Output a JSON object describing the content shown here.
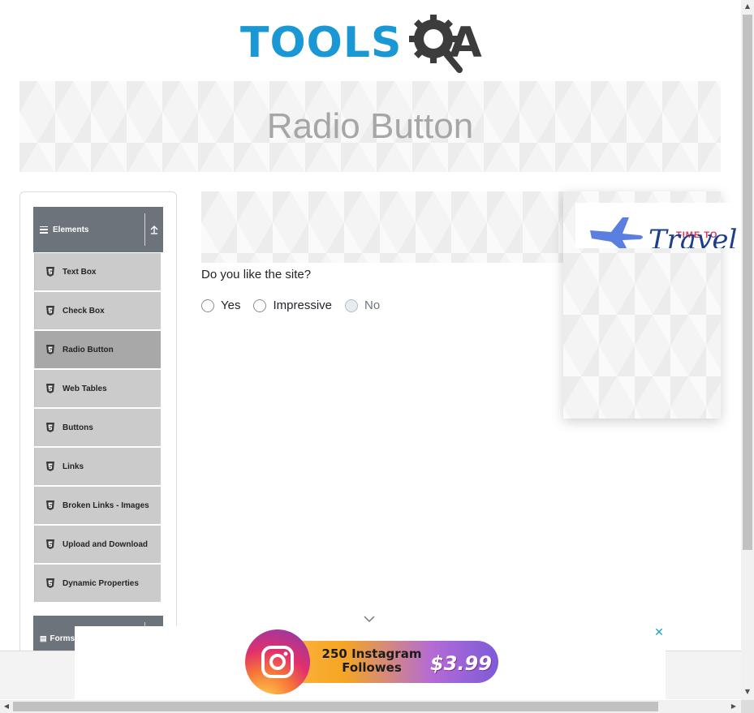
{
  "header": {
    "logo_text_tools": "TOOLS",
    "logo_text_qa": "A"
  },
  "banner": {
    "title": "Radio Button"
  },
  "sidebar": {
    "group_elements": "Elements",
    "group_forms": "Forms",
    "items": [
      {
        "label": "Text Box"
      },
      {
        "label": "Check Box"
      },
      {
        "label": "Radio Button",
        "active": true
      },
      {
        "label": "Web Tables"
      },
      {
        "label": "Buttons"
      },
      {
        "label": "Links"
      },
      {
        "label": "Broken Links - Images"
      },
      {
        "label": "Upload and Download"
      },
      {
        "label": "Dynamic Properties"
      }
    ]
  },
  "main": {
    "question": "Do you like the site?",
    "options": [
      {
        "label": "Yes",
        "selected": false,
        "disabled": false
      },
      {
        "label": "Impressive",
        "selected": false,
        "disabled": false
      },
      {
        "label": "No",
        "selected": false,
        "disabled": true
      }
    ]
  },
  "side_ad": {
    "tag": "TIME TO",
    "script": "Travel"
  },
  "bottom_ad": {
    "text_line1": "250 Instagram",
    "text_line2": "Followes",
    "price": "$3.99",
    "close": "✕"
  },
  "colors": {
    "brand_blue": "#1a97d5",
    "brand_dark": "#3c3c3c",
    "menu_header": "#6c737a",
    "menu_item": "#cbcbcb",
    "menu_item_active": "#a8a8a8"
  },
  "icons": [
    "gear-magnifier-icon",
    "burger-icon",
    "collapse-up-icon",
    "html5-icon",
    "chevron-down-icon",
    "instagram-icon",
    "plane-icon",
    "close-icon"
  ]
}
